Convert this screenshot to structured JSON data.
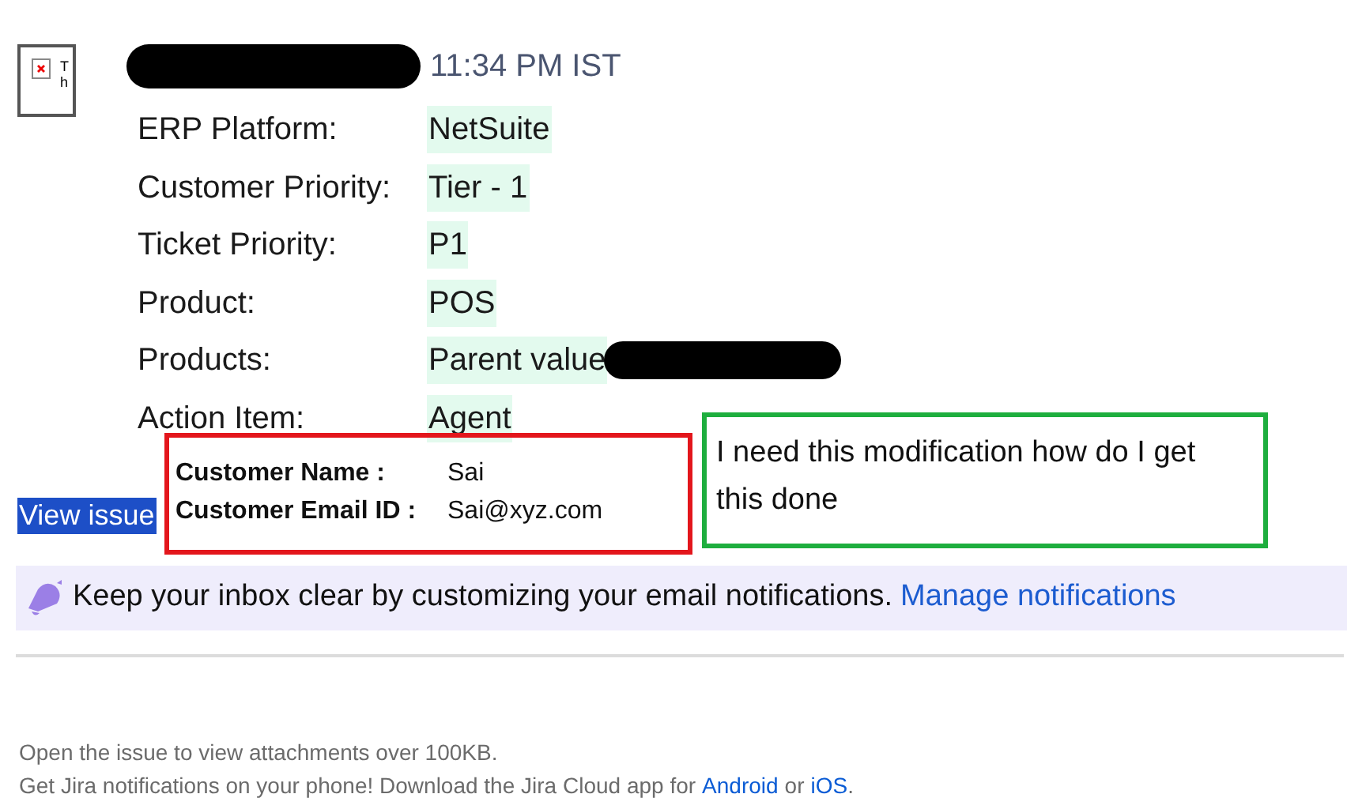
{
  "header": {
    "avatar_alt": "Th",
    "time": "11:34 PM IST"
  },
  "fields": [
    {
      "label": "ERP Platform:",
      "value": "NetSuite",
      "redacted": false
    },
    {
      "label": "Customer Priority:",
      "value": "Tier - 1",
      "redacted": false
    },
    {
      "label": "Ticket Priority:",
      "value": "P1",
      "redacted": false
    },
    {
      "label": "Product:",
      "value": "POS",
      "redacted": false
    },
    {
      "label": "Products:",
      "value": "Parent value",
      "redacted": true
    },
    {
      "label": "Action Item:",
      "value": "Agent",
      "redacted": false
    }
  ],
  "view_issue": "View issue",
  "customer_box": [
    {
      "label": "Customer Name :",
      "value": "Sai"
    },
    {
      "label": "Customer Email ID :",
      "value": "Sai@xyz.com"
    }
  ],
  "note_box": "I need this modification how do I get this done",
  "banner": {
    "text": "Keep your inbox clear by customizing your email notifications.",
    "link": "Manage notifications"
  },
  "footer": [
    {
      "text": "Open the issue to view attachments over 100KB."
    },
    {
      "text": "Get Jira notifications on your phone! Download the Jira Cloud app for",
      "links": [
        "Android",
        "iOS"
      ],
      "joiner": "or",
      "end": "."
    }
  ]
}
